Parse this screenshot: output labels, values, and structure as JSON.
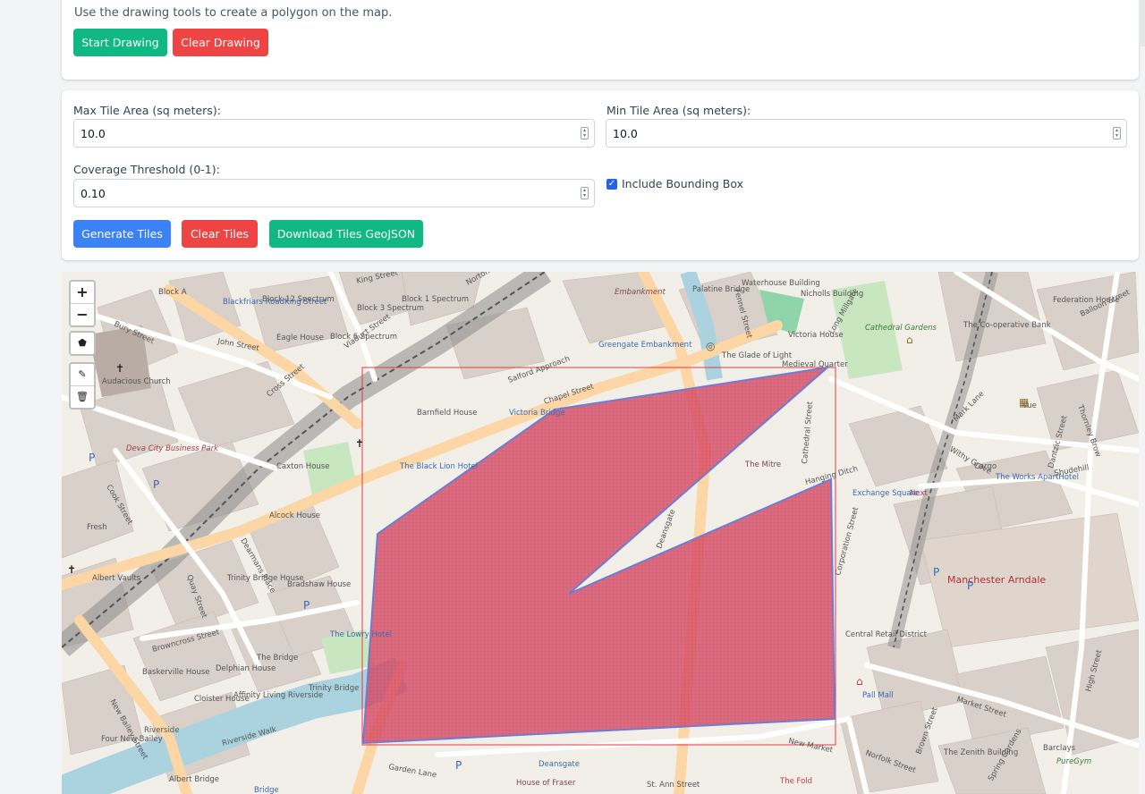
{
  "drawing": {
    "instructions": "Use the drawing tools to create a polygon on the map.",
    "start_label": "Start Drawing",
    "clear_label": "Clear Drawing"
  },
  "params": {
    "max_tile_area_label": "Max Tile Area (sq meters):",
    "max_tile_area_value": "10.0",
    "min_tile_area_label": "Min Tile Area (sq meters):",
    "min_tile_area_value": "10.0",
    "coverage_threshold_label": "Coverage Threshold (0-1):",
    "coverage_threshold_value": "0.10",
    "include_bbox_label": "Include Bounding Box",
    "include_bbox_checked": true,
    "generate_label": "Generate Tiles",
    "clear_tiles_label": "Clear Tiles",
    "download_label": "Download Tiles GeoJSON"
  },
  "map_controls": {
    "zoom_in": "+",
    "zoom_out": "−",
    "draw_polygon_icon": "polygon-icon",
    "edit_icon": "edit-icon",
    "delete_icon": "trash-icon"
  },
  "colors": {
    "green": "#10b981",
    "red": "#ef4444",
    "blue": "#3b82f6",
    "polygon_fill": "#d64562",
    "polygon_stroke": "#6b7fd8",
    "bbox_stroke": "#e63946"
  },
  "map_labels": [
    {
      "id": "king-street",
      "text": "King Street"
    },
    {
      "id": "norton-street",
      "text": "Norton St"
    },
    {
      "id": "palatine-bridge",
      "text": "Palatine Bridge"
    },
    {
      "id": "embankment",
      "text": "Embankment"
    },
    {
      "id": "waterhouse",
      "text": "Waterhouse Building"
    },
    {
      "id": "nicholls",
      "text": "Nicholls Building"
    },
    {
      "id": "cathedral-gardens",
      "text": "Cathedral Gardens"
    },
    {
      "id": "federation-house",
      "text": "Federation House"
    },
    {
      "id": "cooperative-bank",
      "text": "The Co-operative Bank"
    },
    {
      "id": "block-a",
      "text": "Block A"
    },
    {
      "id": "blackfriars-roadking",
      "text": "Blackfriars RoadKing Street"
    },
    {
      "id": "block-12",
      "text": "Block-12 Spectrum"
    },
    {
      "id": "block-3",
      "text": "Block 3 Spectrum"
    },
    {
      "id": "block-1",
      "text": "Block 1 Spectrum"
    },
    {
      "id": "block-6",
      "text": "Block 6 Spectrum"
    },
    {
      "id": "bury-street",
      "text": "Bury Street"
    },
    {
      "id": "john-street",
      "text": "John Street"
    },
    {
      "id": "eagle-house",
      "text": "Eagle House"
    },
    {
      "id": "viaduct-street",
      "text": "Viaduct Street"
    },
    {
      "id": "salford-approach",
      "text": "Salford Approach"
    },
    {
      "id": "greengate",
      "text": "Greengate Embankment"
    },
    {
      "id": "glade-of-light",
      "text": "The Glade of Light"
    },
    {
      "id": "medieval-quarter",
      "text": "Medieval Quarter"
    },
    {
      "id": "victoria-house",
      "text": "Victoria House"
    },
    {
      "id": "audacious-church",
      "text": "Audacious Church"
    },
    {
      "id": "deva-city",
      "text": "Deva City Business Park"
    },
    {
      "id": "cross-street",
      "text": "Cross Street"
    },
    {
      "id": "chapel-street",
      "text": "Chapel Street"
    },
    {
      "id": "barnfield-house",
      "text": "Barnfield House"
    },
    {
      "id": "victoria-bridge",
      "text": "Victoria Bridge"
    },
    {
      "id": "black-lion",
      "text": "The Black Lion Hotel"
    },
    {
      "id": "caxton-house",
      "text": "Caxton House"
    },
    {
      "id": "cook-street",
      "text": "Cook Street"
    },
    {
      "id": "fresh",
      "text": "Fresh"
    },
    {
      "id": "alcock-house",
      "text": "Alcock House"
    },
    {
      "id": "dearmans-place",
      "text": "Dearmans Place"
    },
    {
      "id": "trinity-bridge-house",
      "text": "Trinity Bridge House"
    },
    {
      "id": "bradshaw-house",
      "text": "Bradshaw House"
    },
    {
      "id": "quay-street",
      "text": "Quay Street"
    },
    {
      "id": "albert-vaults",
      "text": "Albert Vaults"
    },
    {
      "id": "lowry-hotel",
      "text": "The Lowry Hotel"
    },
    {
      "id": "browncross",
      "text": "Browncross Street"
    },
    {
      "id": "baskerville",
      "text": "Baskerville House"
    },
    {
      "id": "delphian",
      "text": "Delphian House"
    },
    {
      "id": "the-bridge",
      "text": "The Bridge"
    },
    {
      "id": "cloister",
      "text": "Cloister House"
    },
    {
      "id": "affinity",
      "text": "Affinity Living Riverside"
    },
    {
      "id": "trinity-bridge",
      "text": "Trinity Bridge"
    },
    {
      "id": "riverside",
      "text": "Riverside"
    },
    {
      "id": "riverside-walk",
      "text": "Riverside Walk"
    },
    {
      "id": "four-new-bailey",
      "text": "Four New Bailey"
    },
    {
      "id": "new-bailey-street",
      "text": "New Bailey Street"
    },
    {
      "id": "albert-bridge",
      "text": "Albert Bridge"
    },
    {
      "id": "bridge",
      "text": "Bridge"
    },
    {
      "id": "garden-lane",
      "text": "Garden Lane"
    },
    {
      "id": "deansgate-station",
      "text": "Deansgate"
    },
    {
      "id": "house-of-fraser",
      "text": "House of Fraser"
    },
    {
      "id": "st-ann-street",
      "text": "St. Ann Street"
    },
    {
      "id": "the-fold",
      "text": "The Fold"
    },
    {
      "id": "new-market",
      "text": "New Market"
    },
    {
      "id": "norfolk-street",
      "text": "Norfolk Street"
    },
    {
      "id": "brown-street",
      "text": "Brown Street"
    },
    {
      "id": "the-zenith",
      "text": "The Zenith Building"
    },
    {
      "id": "spring-gardens",
      "text": "Spring Gardens"
    },
    {
      "id": "barclays",
      "text": "Barclays"
    },
    {
      "id": "puregym",
      "text": "PureGym"
    },
    {
      "id": "market-street",
      "text": "Market Street"
    },
    {
      "id": "high-street",
      "text": "High Street"
    },
    {
      "id": "pall-mall",
      "text": "Pall Mall"
    },
    {
      "id": "central-retail",
      "text": "Central Retail District"
    },
    {
      "id": "manchester-arndale",
      "text": "Manchester Arndale"
    },
    {
      "id": "next",
      "text": "Next"
    },
    {
      "id": "exchange-square",
      "text": "Exchange Square"
    },
    {
      "id": "hanging-ditch",
      "text": "Hanging Ditch"
    },
    {
      "id": "cathedral-street",
      "text": "Cathedral Street"
    },
    {
      "id": "the-mitre",
      "text": "The Mitre"
    },
    {
      "id": "deansgate",
      "text": "Deansgate"
    },
    {
      "id": "corporation-street",
      "text": "Corporation Street"
    },
    {
      "id": "withy-grove",
      "text": "Withy Grove"
    },
    {
      "id": "the-works",
      "text": "The Works ApartHotel"
    },
    {
      "id": "cargo",
      "text": "Cargo"
    },
    {
      "id": "shudehill",
      "text": "Shudehill"
    },
    {
      "id": "vue",
      "text": "Vue"
    },
    {
      "id": "dantzic-street",
      "text": "Dantzic Street"
    },
    {
      "id": "mark-lane",
      "text": "Mark Lane"
    },
    {
      "id": "thornley-brow",
      "text": "Thornley Brow"
    },
    {
      "id": "balloon-street",
      "text": "Balloon Street"
    },
    {
      "id": "long-millgate",
      "text": "Long Millgate"
    },
    {
      "id": "fennel-street",
      "text": "Fennel Street"
    },
    {
      "id": "gartside",
      "text": "Spring Gardens"
    }
  ]
}
